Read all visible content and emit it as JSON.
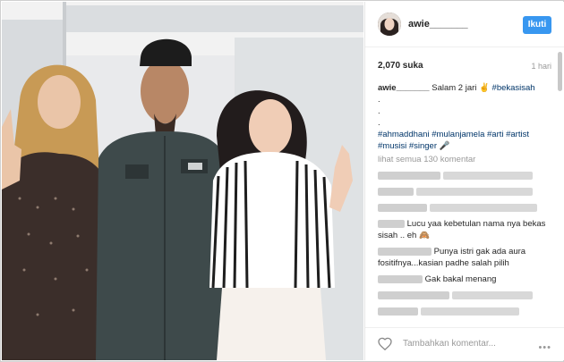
{
  "post": {
    "username": "awie_______",
    "follow_label": "Ikuti",
    "likes": "2,070 suka",
    "time": "1 hari",
    "caption": {
      "user": "awie_______",
      "text": "Salam 2 jari",
      "emoji": "✌",
      "hashtag1": "#bekasisah",
      "dot1": ".",
      "dot2": ".",
      "dot3": ".",
      "hashtags": "#ahmaddhani #mulanjamela #arti #artist #musisi #singer",
      "mic_emoji": "🎤"
    },
    "view_all": "lihat semua 130 komentar",
    "comments": [
      {
        "text": "Lucu yaa kebetulan nama nya bekas sisah .. eh",
        "emoji": "🙈"
      },
      {
        "text": "Punya istri gak ada aura fositifnya...kasian padhe salah pilih"
      },
      {
        "text": "Gak bakal menang"
      }
    ],
    "add_comment_placeholder": "Tambahkan komentar...",
    "more_label": "•••"
  },
  "colors": {
    "accent": "#3897f0",
    "hashtag": "#003569",
    "muted": "#999999",
    "text": "#262626"
  },
  "icons": {
    "avatar": "profile-avatar",
    "heart": "heart-icon",
    "more": "more-options-icon"
  }
}
